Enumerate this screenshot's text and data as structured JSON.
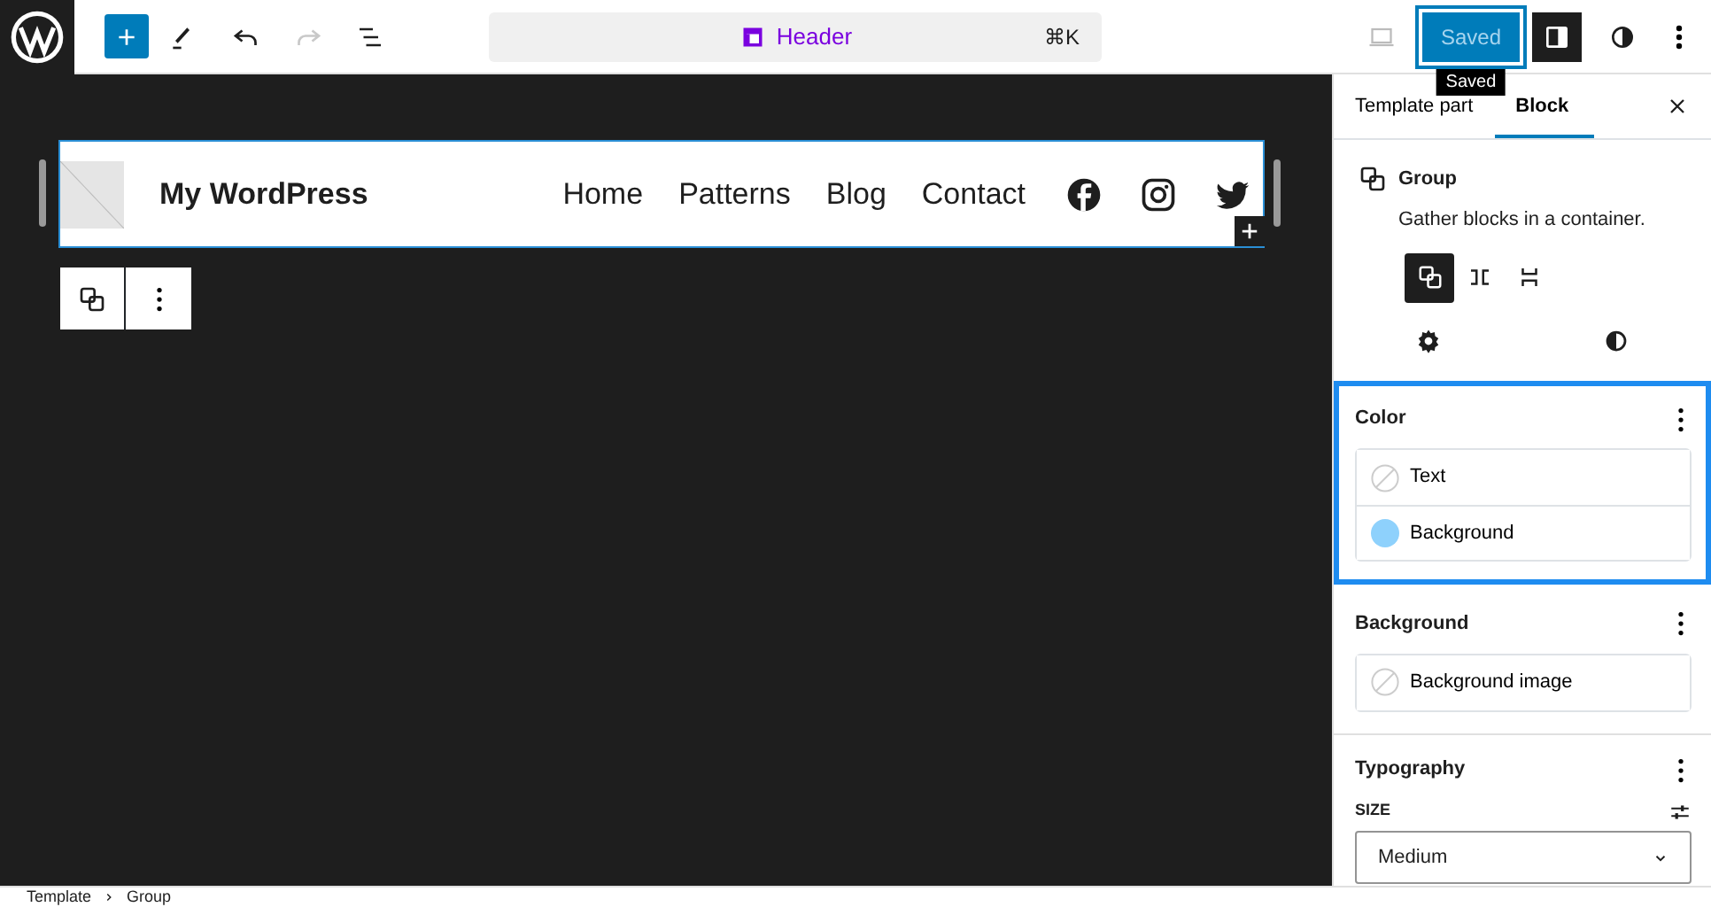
{
  "toolbar": {
    "undo": {
      "disabled": false
    },
    "redo": {
      "disabled": true
    }
  },
  "command_bar": {
    "title": "Header",
    "shortcut": "⌘K"
  },
  "save_button": {
    "label": "Saved",
    "tooltip": "Saved"
  },
  "settings_toggle": {
    "pressed": true
  },
  "canvas": {
    "site_title": "My WordPress",
    "nav": [
      "Home",
      "Patterns",
      "Blog",
      "Contact"
    ],
    "social": [
      {
        "kind": "facebook"
      },
      {
        "kind": "instagram"
      },
      {
        "kind": "twitter"
      }
    ]
  },
  "sidebar": {
    "tabs": [
      {
        "label": "Template part",
        "selected": false
      },
      {
        "label": "Block",
        "selected": true
      }
    ],
    "block": {
      "name": "Group",
      "description": "Gather blocks in a container."
    },
    "variations": [
      {
        "kind": "group",
        "selected": true
      },
      {
        "kind": "row",
        "selected": false
      },
      {
        "kind": "stack",
        "selected": false
      }
    ],
    "panels": [
      {
        "title": "Color",
        "highlighted": true,
        "items": [
          {
            "label": "Text",
            "kind": "empty"
          },
          {
            "label": "Background",
            "kind": "swatch",
            "color": "#8ed1fc"
          }
        ]
      },
      {
        "title": "Background",
        "highlighted": false,
        "items": [
          {
            "label": "Background image",
            "kind": "empty"
          }
        ]
      }
    ],
    "typography": {
      "title": "Typography",
      "size_label": "SIZE",
      "size_value": "Medium"
    }
  },
  "breadcrumb": [
    "Template",
    "Group"
  ]
}
